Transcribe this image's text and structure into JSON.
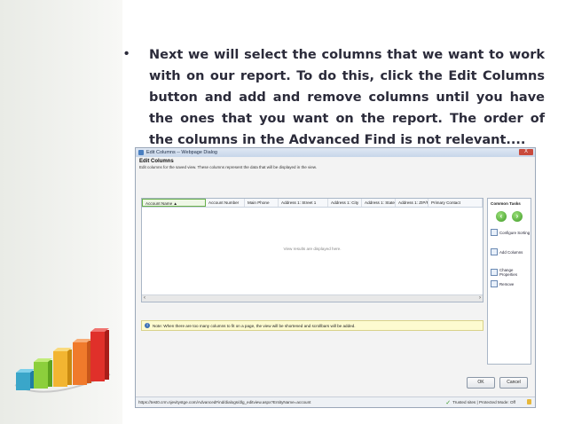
{
  "slide": {
    "bullet": "•",
    "text": "Next we will select the columns that we want to work with on our report. To do this, click the Edit Columns button and add and remove columns until you have the ones that you want on the report. The order of the columns in the Advanced Find is not relevant...."
  },
  "dialog": {
    "title": "Edit Columns -- Webpage Dialog",
    "close_label": "X",
    "heading": "Edit Columns",
    "description": "Edit columns for the saved view. These columns represent the data that will be displayed in the view.",
    "columns": [
      "Account Name ▲",
      "Account Number",
      "Main Phone",
      "Address 1: Street 1",
      "Address 1: City",
      "Address 1: State...",
      "Address 1: ZIP/P...",
      "Primary Contact"
    ],
    "empty_message": "View results are displayed here.",
    "note": "Note: When there are too many columns to fit on a page, the view will be shortened and scrollbars will be added.",
    "common_tasks": {
      "title": "Common Tasks",
      "items": [
        "Configure Sorting",
        "Add Columns",
        "Change Properties",
        "Remove"
      ]
    },
    "ok_label": "OK",
    "cancel_label": "Cancel",
    "status_url": "https://test0.crm.njevitystge.com/AdvancedFind/dialogs/dlg_editview.aspx?EntityName=account",
    "status_mode": "Trusted sites | Protected Mode: Off"
  },
  "colors": {
    "text": "#2b2b3a",
    "accent_green": "#68b04b",
    "note_bg": "#fdfbd0"
  },
  "decor": {
    "chart_icon": "bar-chart-graphic"
  }
}
